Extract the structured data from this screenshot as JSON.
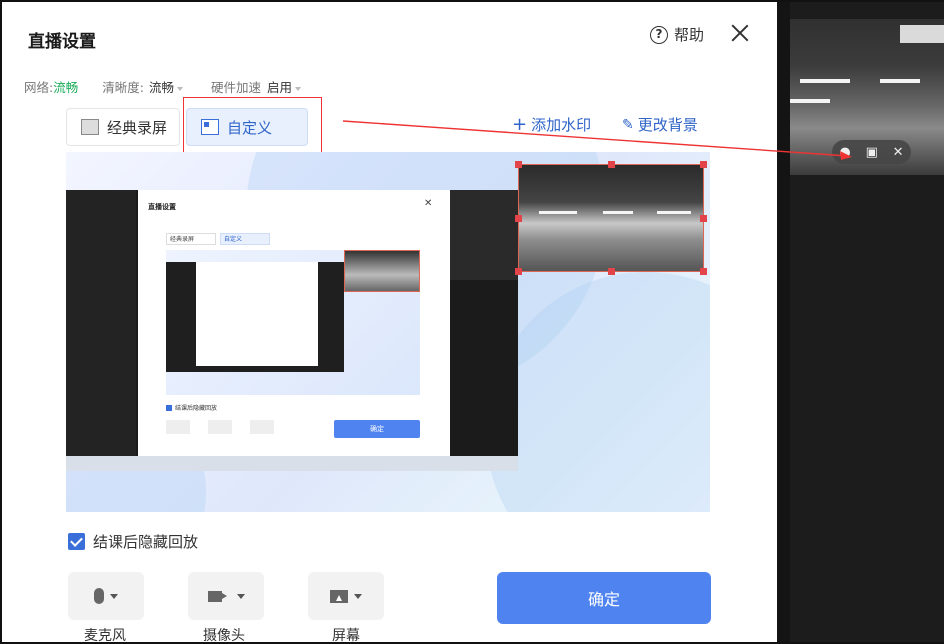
{
  "dialog": {
    "title": "直播设置",
    "help_label": "帮助",
    "help_icon": "question-circle-icon",
    "close_icon": "close-icon"
  },
  "info": {
    "network_label": "网络:",
    "network_value": "流畅",
    "clarity_label": "清晰度:",
    "clarity_value": "流畅",
    "hw_label": "硬件加速",
    "hw_value": "启用"
  },
  "tabs": [
    {
      "label": "经典录屏",
      "selected": false
    },
    {
      "label": "自定义",
      "selected": true
    }
  ],
  "actions": {
    "add_watermark": "添加水印",
    "change_background": "更改背景"
  },
  "preview": {
    "inner_title": "直播设置",
    "inner_tab1": "经典录屏",
    "inner_tab2": "自定义",
    "inner_confirm": "确定",
    "inner_hide_playback": "结课后隐藏回放"
  },
  "hide_playback": {
    "label": "结课后隐藏回放",
    "checked": true
  },
  "devices": [
    {
      "label": "麦克风",
      "icon": "microphone-icon"
    },
    {
      "label": "摄像头",
      "icon": "camera-icon"
    },
    {
      "label": "屏幕",
      "icon": "screen-icon"
    }
  ],
  "confirm_label": "确定",
  "colors": {
    "accent": "#4e83f0",
    "link": "#2f64c8",
    "green": "#1aad5a",
    "annotation_red": "#e33"
  }
}
